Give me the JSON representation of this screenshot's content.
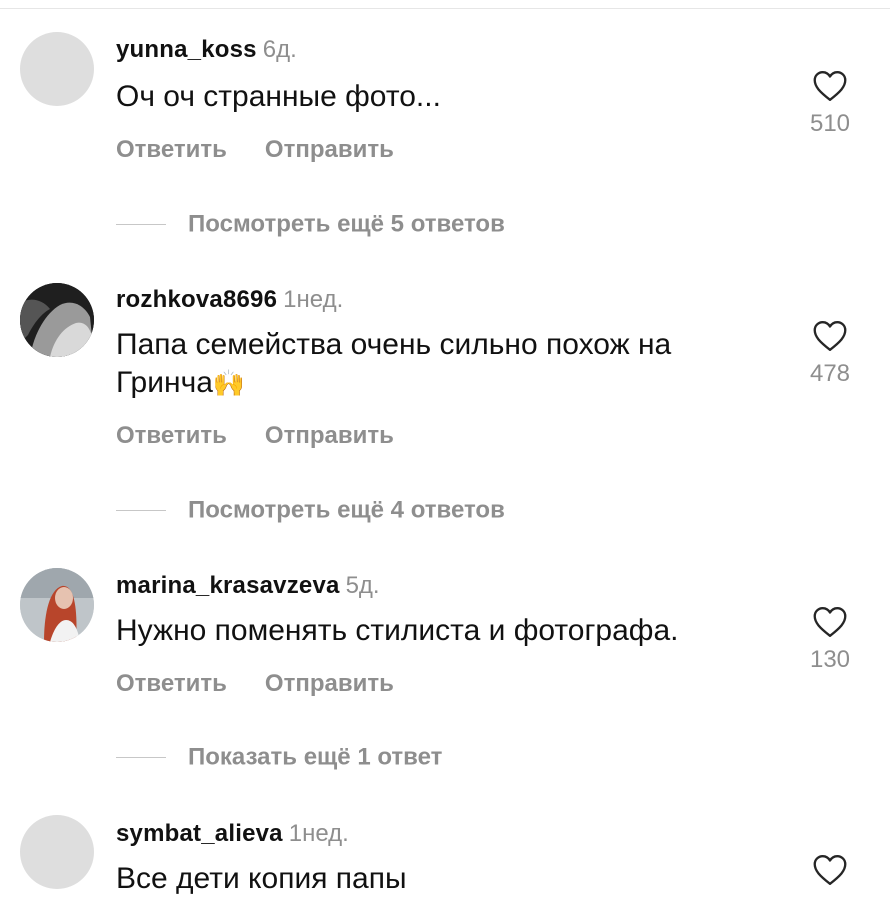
{
  "labels": {
    "reply": "Ответить",
    "send": "Отправить"
  },
  "comments": [
    {
      "username": "yunna_koss",
      "time": "6д.",
      "text": "Оч оч странные фото...",
      "likes": "510",
      "replies_label": "Посмотреть ещё 5 ответов"
    },
    {
      "username": "rozhkova8696",
      "time": "1нед.",
      "text_line1": "Папа семейства очень сильно похож на",
      "text_line2": "Гринча",
      "emoji": "🙌",
      "likes": "478",
      "replies_label": "Посмотреть ещё 4 ответов"
    },
    {
      "username": "marina_krasavzeva",
      "time": "5д.",
      "text": "Нужно поменять стилиста и фотографа.",
      "likes": "130",
      "replies_label": "Показать ещё 1 ответ"
    },
    {
      "username": "symbat_alieva",
      "time": "1нед.",
      "text": "Все дети копия папы"
    }
  ],
  "colors": {
    "muted": "#8e8e8e",
    "text": "#111111",
    "placeholder_avatar": "#dedede"
  }
}
